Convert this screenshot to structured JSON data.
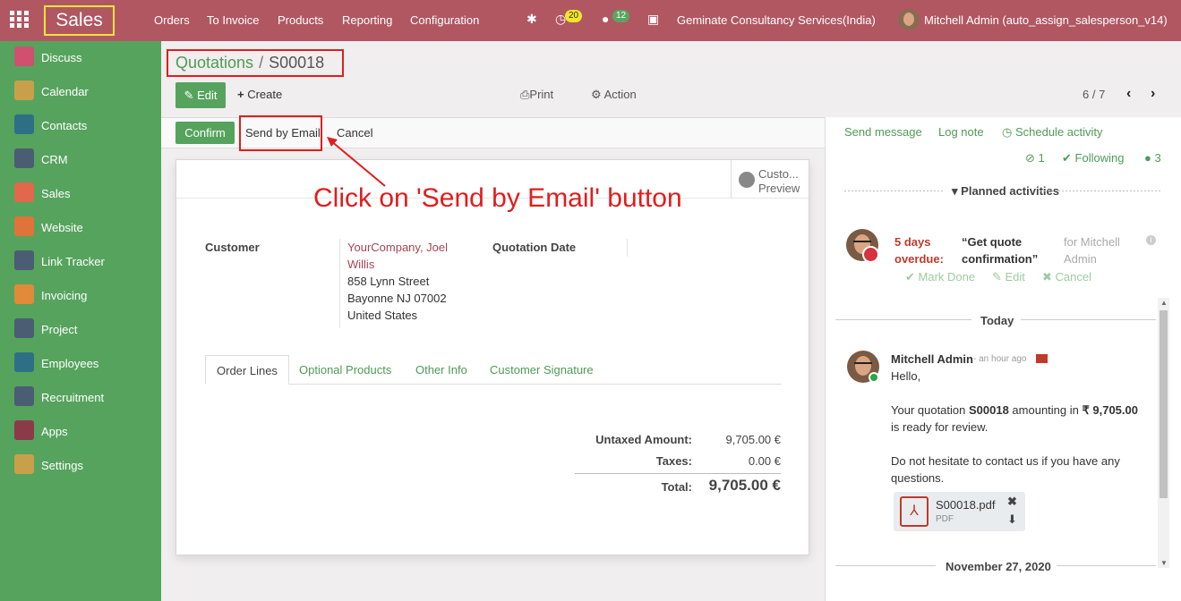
{
  "topbar": {
    "brand": "Sales",
    "menu": [
      "Orders",
      "To Invoice",
      "Products",
      "Reporting",
      "Configuration"
    ],
    "activity_badge": "20",
    "message_badge": "12",
    "company": "Geminate Consultancy Services(India)",
    "user": "Mitchell Admin (auto_assign_salesperson_v14)"
  },
  "sidebar": {
    "items": [
      {
        "label": "Discuss",
        "icon": "discuss-icon",
        "color": "#d14f6f"
      },
      {
        "label": "Calendar",
        "icon": "calendar-icon",
        "color": "#c8a04a"
      },
      {
        "label": "Contacts",
        "icon": "contacts-icon",
        "color": "#2f6f85"
      },
      {
        "label": "CRM",
        "icon": "crm-icon",
        "color": "#4b5d73"
      },
      {
        "label": "Sales",
        "icon": "sales-icon",
        "color": "#e2684b"
      },
      {
        "label": "Website",
        "icon": "website-icon",
        "color": "#e0733a"
      },
      {
        "label": "Link Tracker",
        "icon": "link-tracker-icon",
        "color": "#4b5d73"
      },
      {
        "label": "Invoicing",
        "icon": "invoicing-icon",
        "color": "#e08a3a"
      },
      {
        "label": "Project",
        "icon": "project-icon",
        "color": "#4b5d73"
      },
      {
        "label": "Employees",
        "icon": "employees-icon",
        "color": "#2f6f85"
      },
      {
        "label": "Recruitment",
        "icon": "recruitment-icon",
        "color": "#4b5d73"
      },
      {
        "label": "Apps",
        "icon": "apps-icon",
        "color": "#8b3a4a"
      },
      {
        "label": "Settings",
        "icon": "settings-icon",
        "color": "#c8a04a"
      }
    ]
  },
  "breadcrumb": {
    "parent": "Quotations",
    "sep": "/",
    "current": "S00018"
  },
  "controls": {
    "edit": "Edit",
    "create": "Create",
    "print": "Print",
    "action": "Action",
    "pager": "6 / 7"
  },
  "statusbar": {
    "confirm": "Confirm",
    "send_email": "Send by Email",
    "cancel": "Cancel"
  },
  "portal": {
    "line1": "Custo...",
    "line2": "Preview"
  },
  "form": {
    "customer_label": "Customer",
    "customer_name_1": "YourCompany, Joel",
    "customer_name_2": "Willis",
    "addr1": "858 Lynn Street",
    "addr2": "Bayonne NJ 07002",
    "addr3": "United States",
    "quotation_date_label": "Quotation Date"
  },
  "tabs": [
    "Order Lines",
    "Optional Products",
    "Other Info",
    "Customer Signature"
  ],
  "totals": {
    "untaxed_label": "Untaxed Amount:",
    "untaxed": "9,705.00 €",
    "taxes_label": "Taxes:",
    "taxes": "0.00 €",
    "total_label": "Total:",
    "total": "9,705.00 €"
  },
  "annotation": "Click on 'Send by Email' button",
  "chatter": {
    "send_message": "Send message",
    "log_note": "Log note",
    "schedule_activity": "Schedule activity",
    "attachments_count": "1",
    "following": "Following",
    "followers_count": "3",
    "planned_activities": "Planned activities",
    "activity": {
      "overdue_1": "5 days",
      "overdue_2": "overdue:",
      "title_1": "“Get quote",
      "title_2": "confirmation”",
      "for_1": "for Mitchell",
      "for_2": "Admin",
      "mark_done": "Mark Done",
      "edit": "Edit",
      "cancel": "Cancel"
    },
    "today": "Today",
    "message": {
      "author": "Mitchell Admin",
      "time": "- an hour ago",
      "greeting": "Hello,",
      "line1_pre": "Your quotation ",
      "line1_ref": "S00018",
      "line1_mid": " amounting in ",
      "line1_amount": "₹ 9,705.00",
      "line2": "is ready for review.",
      "line3": "Do not hesitate to contact us if you have any",
      "line4": "questions.",
      "attachment_name": "S00018.pdf",
      "attachment_type": "PDF"
    },
    "next_date": "November 27, 2020"
  }
}
